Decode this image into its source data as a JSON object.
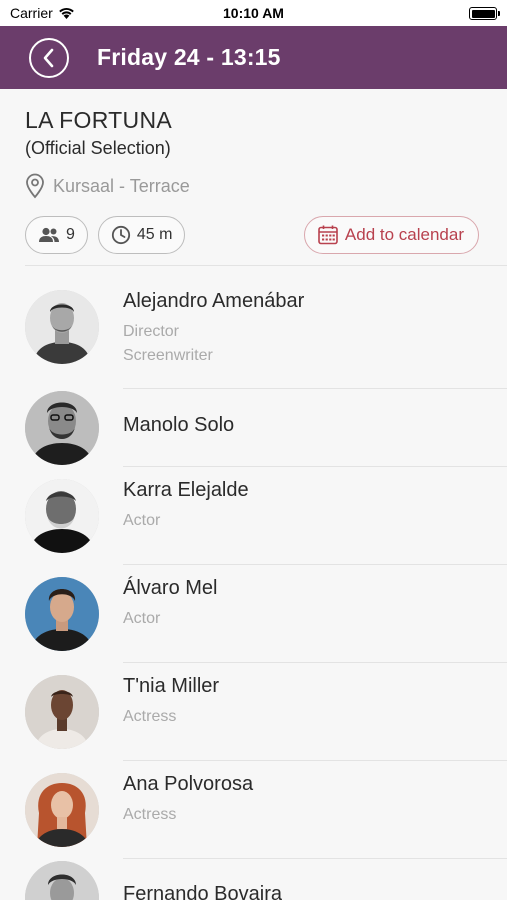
{
  "status_bar": {
    "carrier": "Carrier",
    "time": "10:10 AM"
  },
  "nav": {
    "title": "Friday 24 - 13:15"
  },
  "event": {
    "title": "LA FORTUNA",
    "subtitle": "(Official Selection)",
    "location": "Kursaal - Terrace",
    "attendees": "9",
    "duration": "45 m",
    "calendar_label": "Add to calendar"
  },
  "people": [
    {
      "name": "Alejandro Amenábar",
      "roles": [
        "Director",
        "Screenwriter"
      ]
    },
    {
      "name": "Manolo Solo",
      "roles": []
    },
    {
      "name": "Karra Elejalde",
      "roles": [
        "Actor"
      ]
    },
    {
      "name": "Álvaro Mel",
      "roles": [
        "Actor"
      ]
    },
    {
      "name": "T'nia Miller",
      "roles": [
        "Actress"
      ]
    },
    {
      "name": "Ana Polvorosa",
      "roles": [
        "Actress"
      ]
    },
    {
      "name": "Fernando Bovaira",
      "roles": []
    }
  ],
  "colors": {
    "nav_bg": "#6b3d6b",
    "accent": "#b8414e"
  }
}
